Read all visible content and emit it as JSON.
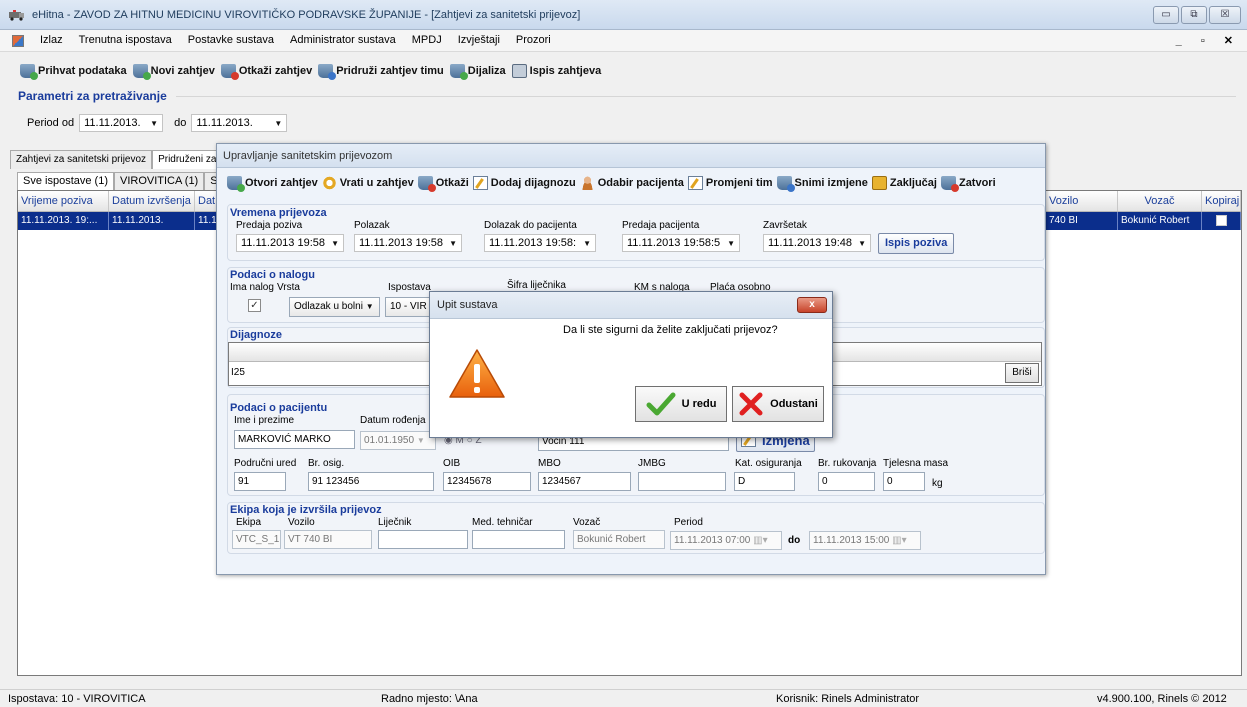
{
  "window": {
    "title": "eHitna - ZAVOD ZA HITNU MEDICINU VIROVITIČKO PODRAVSKE ŽUPANIJE - [Zahtjevi za sanitetski prijevoz]"
  },
  "menu": [
    "Izlaz",
    "Trenutna ispostava",
    "Postavke sustava",
    "Administrator sustava",
    "MPDJ",
    "Izvještaji",
    "Prozori"
  ],
  "toolbar": [
    "Prihvat podataka",
    "Novi zahtjev",
    "Otkaži zahtjev",
    "Pridruži zahtjev timu",
    "Dijaliza",
    "Ispis zahtjeva"
  ],
  "params": {
    "title": "Parametri za pretraživanje",
    "period_label": "Period od",
    "from": "11.11.2013.",
    "to_label": "do",
    "to": "11.11.2013."
  },
  "tabs": [
    "Zahtjevi za sanitetski prijevoz",
    "Pridruženi zah"
  ],
  "subtabs": [
    "Sve ispostave (1)",
    "VIROVITICA (1)",
    "SLAT"
  ],
  "grid": {
    "headers_left": [
      "Vrijeme poziva",
      "Datum izvršenja",
      "Dat"
    ],
    "row_left": [
      "11.11.2013. 19:...",
      "11.11.2013.",
      "11.11"
    ],
    "headers_right": [
      "Vozilo",
      "Vozač",
      "Kopiraj"
    ],
    "row_right": [
      "740 BI",
      "Bokunić Robert",
      ""
    ]
  },
  "dialog": {
    "title": "Upravljanje sanitetskim prijevozom",
    "toolbar": [
      "Otvori zahtjev",
      "Vrati u zahtjev",
      "Otkaži",
      "Dodaj dijagnozu",
      "Odabir pacijenta",
      "Promjeni tim",
      "Snimi izmjene",
      "Zaključaj",
      "Zatvori"
    ],
    "times": {
      "title": "Vremena prijevoza",
      "labels": [
        "Predaja poziva",
        "Polazak",
        "Dolazak do pacijenta",
        "Predaja pacijenta",
        "Završetak"
      ],
      "values": [
        "11.11.2013 19:58",
        "11.11.2013 19:58",
        "11.11.2013 19:58:",
        "11.11.2013 19:58:5",
        "11.11.2013 19:48"
      ],
      "print_button": "Ispis poziva"
    },
    "order": {
      "title": "Podaci o nalogu",
      "labels": [
        "Ima nalog",
        "Vrsta",
        "Ispostava",
        "Šifra liječnika",
        "KM s naloga",
        "Plaća osobno"
      ],
      "checkmark": "✓",
      "vrsta": "Odlazak u bolni",
      "ispostava": "10 - VIR"
    },
    "diag": {
      "title": "Dijagnoze",
      "header": "MKB",
      "value": "I25",
      "delete": "Briši"
    },
    "patient": {
      "title": "Podaci o pacijentu",
      "name_label": "Ime i prezime",
      "name": "MARKOVIĆ MARKO",
      "dob_label": "Datum rođenja",
      "dob": "01.01.1950",
      "sex_m": "M",
      "sex_z": "Ž",
      "address": "Voćin 111",
      "edit_button": "Izmjena",
      "labels2": [
        "Područni ured",
        "Br. osig.",
        "OIB",
        "MBO",
        "JMBG",
        "Kat. osiguranja",
        "Br. rukovanja",
        "Tjelesna masa"
      ],
      "values2": [
        "91",
        "91 123456",
        "12345678",
        "1234567",
        "",
        "D",
        "0",
        "0"
      ],
      "kg": "kg"
    },
    "team": {
      "title": "Ekipa koja je izvršila prijevoz",
      "labels": [
        "Ekipa",
        "Vozilo",
        "Liječnik",
        "Med. tehničar",
        "Vozač",
        "Period"
      ],
      "ekipa": "VTC_S_1",
      "vozilo": "VT 740 BI",
      "lijecnik": "",
      "tehnicar": "",
      "vozac": "Bokunić Robert",
      "period_from": "11.11.2013 07:00",
      "do": "do",
      "period_to": "11.11.2013 15:00"
    }
  },
  "msgbox": {
    "title": "Upit sustava",
    "text": "Da li ste sigurni da želite zaključati prijevoz?",
    "ok": "U redu",
    "cancel": "Odustani",
    "close": "x"
  },
  "status": {
    "ispostava": "Ispostava: 10 - VIROVITICA",
    "radno": "Radno mjesto: \\Ana",
    "korisnik": "Korisnik: Rinels Administrator",
    "version": "v4.900.100, Rinels © 2012"
  }
}
